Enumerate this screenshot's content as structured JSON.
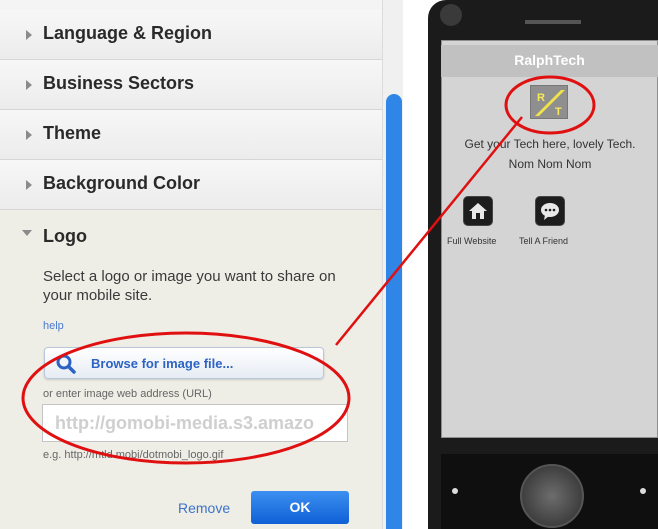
{
  "settings": {
    "sections": [
      {
        "label": "Language & Region"
      },
      {
        "label": "Business Sectors"
      },
      {
        "label": "Theme"
      },
      {
        "label": "Background Color"
      }
    ],
    "logo": {
      "title": "Logo",
      "description": "Select a logo or image you want to share on your mobile site.",
      "help_link": "help",
      "browse_label": "Browse for image file...",
      "url_label": "or enter image web address (URL)",
      "url_value": "http://gomobi-media.s3.amazo",
      "example": "e.g. http://mtld.mobi/dotmobi_logo.gif",
      "remove_label": "Remove",
      "ok_label": "OK"
    }
  },
  "phone": {
    "app_title": "RalphTech",
    "logo_letters": [
      "R",
      "T"
    ],
    "tagline": "Get your Tech here, lovely Tech. Nom Nom Nom",
    "icons": [
      {
        "label": "Full Website",
        "icon": "home-icon"
      },
      {
        "label": "Tell A Friend",
        "icon": "chat-icon"
      }
    ]
  },
  "colors": {
    "accent_blue": "#1a6fe0",
    "annotation_red": "#e01010",
    "panel_bg": "#f4f4f4"
  }
}
